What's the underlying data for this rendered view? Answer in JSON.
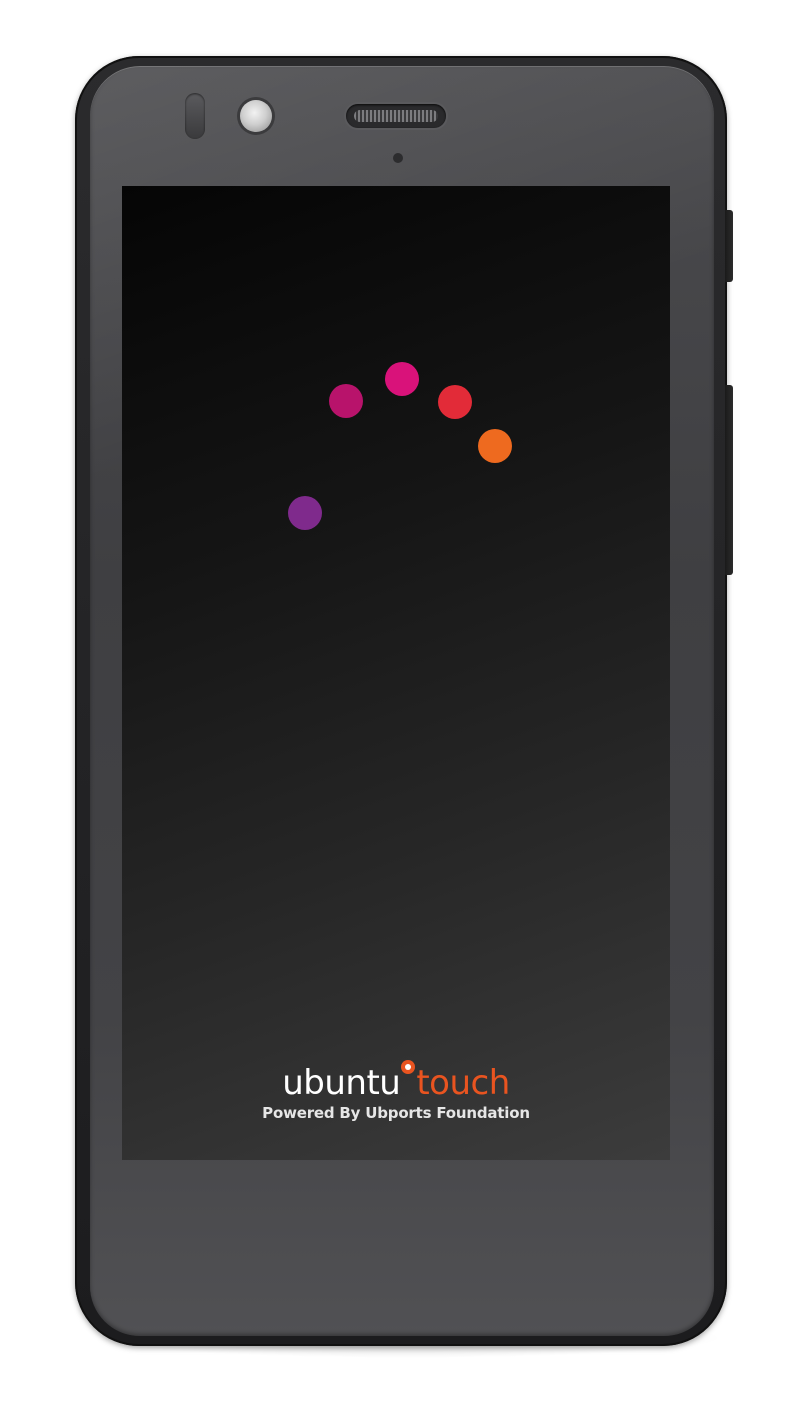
{
  "boot_screen": {
    "spinner": {
      "dots": [
        {
          "color": "#b8136b"
        },
        {
          "color": "#d9127a"
        },
        {
          "color": "#e22b38"
        },
        {
          "color": "#ee6a1f"
        },
        {
          "color": "#7f2a8c"
        }
      ]
    },
    "logo": {
      "ubuntu": "ubuntu",
      "touch": "touch",
      "tagline": "Powered By Ubports Foundation"
    },
    "colors": {
      "brand_orange": "#e95420",
      "screen_background": "#111111",
      "device_body": "#444447"
    }
  }
}
